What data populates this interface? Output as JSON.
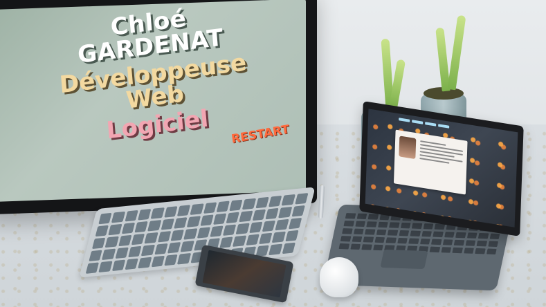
{
  "monitor": {
    "hero": {
      "name": "Chloé GARDENAT",
      "title": "Développeuse Web",
      "subtitle": "Logiciel"
    },
    "restart_label": "RESTART"
  },
  "colors": {
    "accent_orange": "#ff6a3d",
    "title_yellow": "#f3d9a0",
    "subtitle_pink": "#f2a6b2",
    "screen_green": "#9fb3a6"
  }
}
